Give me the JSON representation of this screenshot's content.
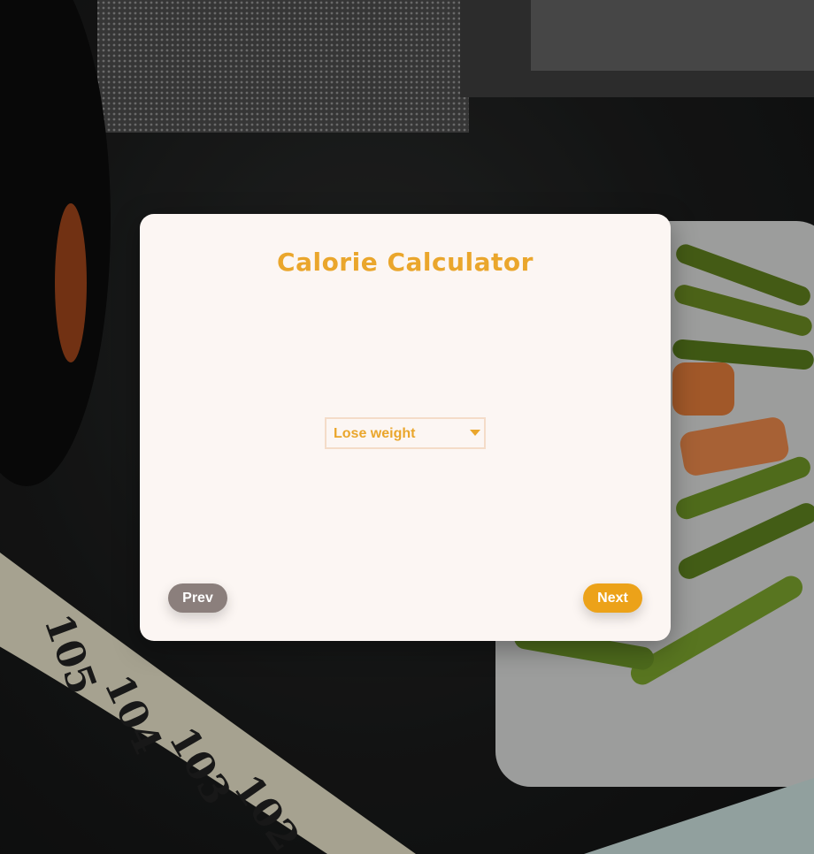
{
  "app": {
    "title": "Calorie Calculator"
  },
  "form": {
    "goal_select": {
      "selected": "Lose weight"
    }
  },
  "nav": {
    "prev_label": "Prev",
    "next_label": "Next"
  },
  "background": {
    "tape_numbers": [
      "105",
      "104",
      "103",
      "102"
    ]
  },
  "colors": {
    "accent": "#eaa62c",
    "next_button": "#eca219",
    "prev_button": "#8b7f7c",
    "card_bg": "#fcf6f3"
  }
}
